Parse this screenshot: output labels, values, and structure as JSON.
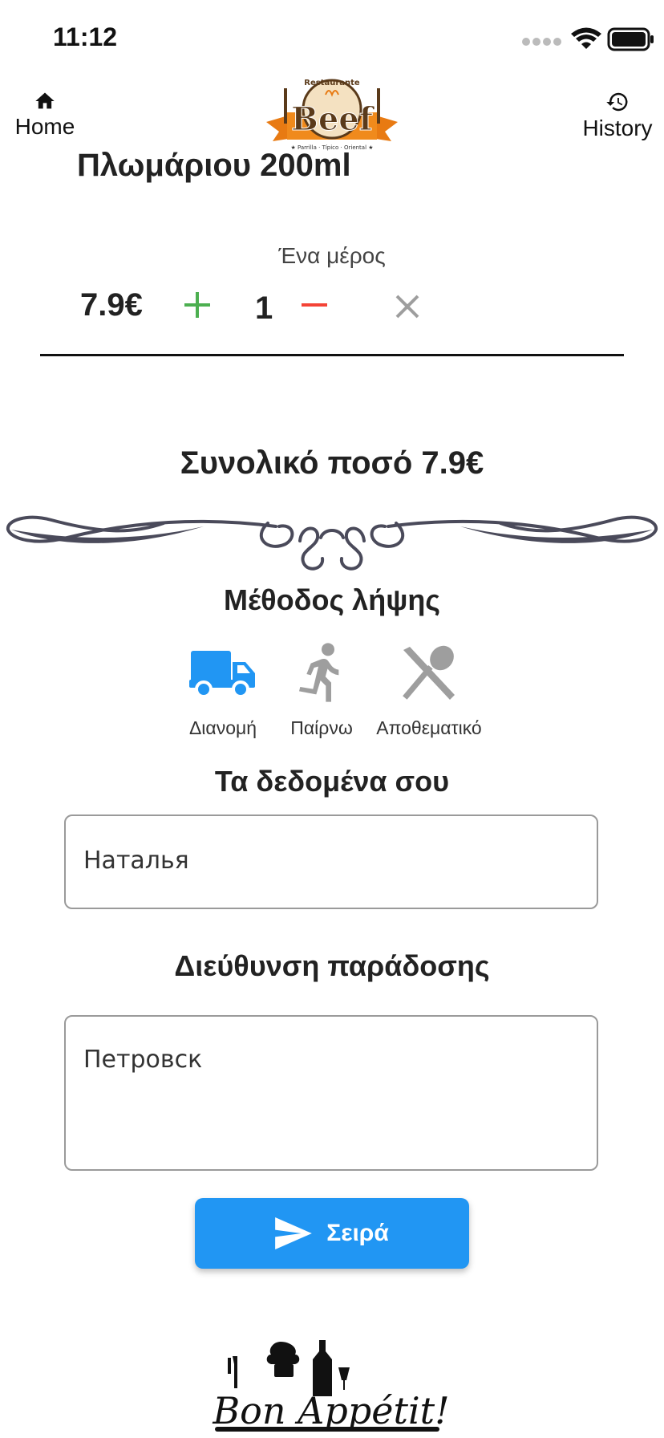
{
  "status_bar": {
    "time": "11:12"
  },
  "header": {
    "home_label": "Home",
    "history_label": "History",
    "logo_text": "Beef",
    "logo_top_text": "Restaurante",
    "logo_bottom_text": "Parrilla · Típico · Oriental"
  },
  "cart_item": {
    "title": "Πλωμάριου 200ml",
    "portion": "Ένα μέρος",
    "price": "7.9€",
    "quantity": "1"
  },
  "total": {
    "text": "Συνολικό ποσό 7.9€"
  },
  "receipt_method": {
    "heading": "Μέθοδος λήψης",
    "options": [
      {
        "label": "Διανομή",
        "icon": "truck-icon",
        "selected": true
      },
      {
        "label": "Παίρνω",
        "icon": "running-person-icon",
        "selected": false
      },
      {
        "label": "Αποθεματικό",
        "icon": "utensils-icon",
        "selected": false
      }
    ]
  },
  "your_data": {
    "heading": "Τα δεδομένα σου",
    "name_value": "Наталья"
  },
  "delivery_address": {
    "heading": "Διεύθυνση παράδοσης",
    "address_value": "Петровск"
  },
  "order_button": {
    "label": "Σειρά"
  },
  "footer": {
    "logo_text": "Bon Appétit!"
  },
  "colors": {
    "accent_blue": "#2196f3",
    "plus_green": "#4caf50",
    "minus_red": "#f44336",
    "inactive_grey": "#9e9e9e",
    "logo_orange": "#f08a1c"
  }
}
